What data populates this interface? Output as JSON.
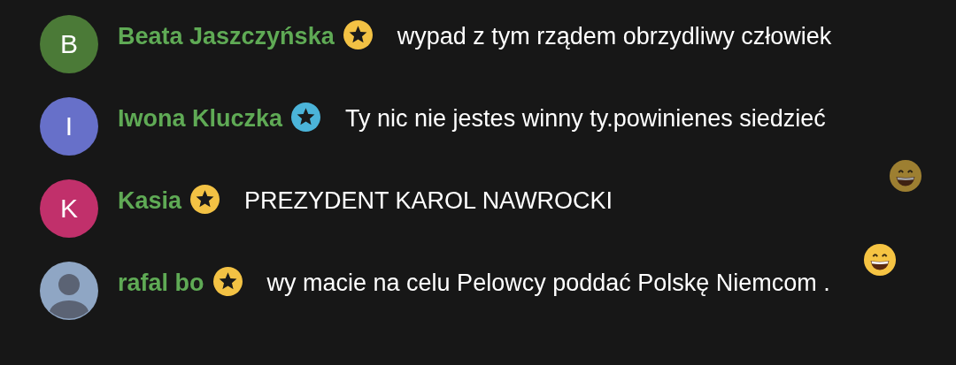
{
  "messages": [
    {
      "author": "Beata Jaszczyńska",
      "avatar": {
        "kind": "initial",
        "letter": "B",
        "color": "#4b7a37"
      },
      "badge": {
        "color": "#f3c244"
      },
      "text": "wypad z tym rządem obrzydliwy człowiek"
    },
    {
      "author": "Iwona Kluczka",
      "avatar": {
        "kind": "initial",
        "letter": "I",
        "color": "#6770c9"
      },
      "badge": {
        "color": "#4bb4d9"
      },
      "text": "Ty nic nie jestes winny ty.powinienes siedzieć"
    },
    {
      "author": "Kasia",
      "avatar": {
        "kind": "initial",
        "letter": "K",
        "color": "#c1306b"
      },
      "badge": {
        "color": "#f3c244"
      },
      "text": "PREZYDENT KAROL NAWROCKI"
    },
    {
      "author": "rafal bo",
      "avatar": {
        "kind": "photo"
      },
      "badge": {
        "color": "#f3c244"
      },
      "text": "wy macie na celu Pelowcy poddać Polskę Niemcom ."
    }
  ],
  "reactions": [
    {
      "faded": true
    },
    {
      "faded": false
    }
  ]
}
